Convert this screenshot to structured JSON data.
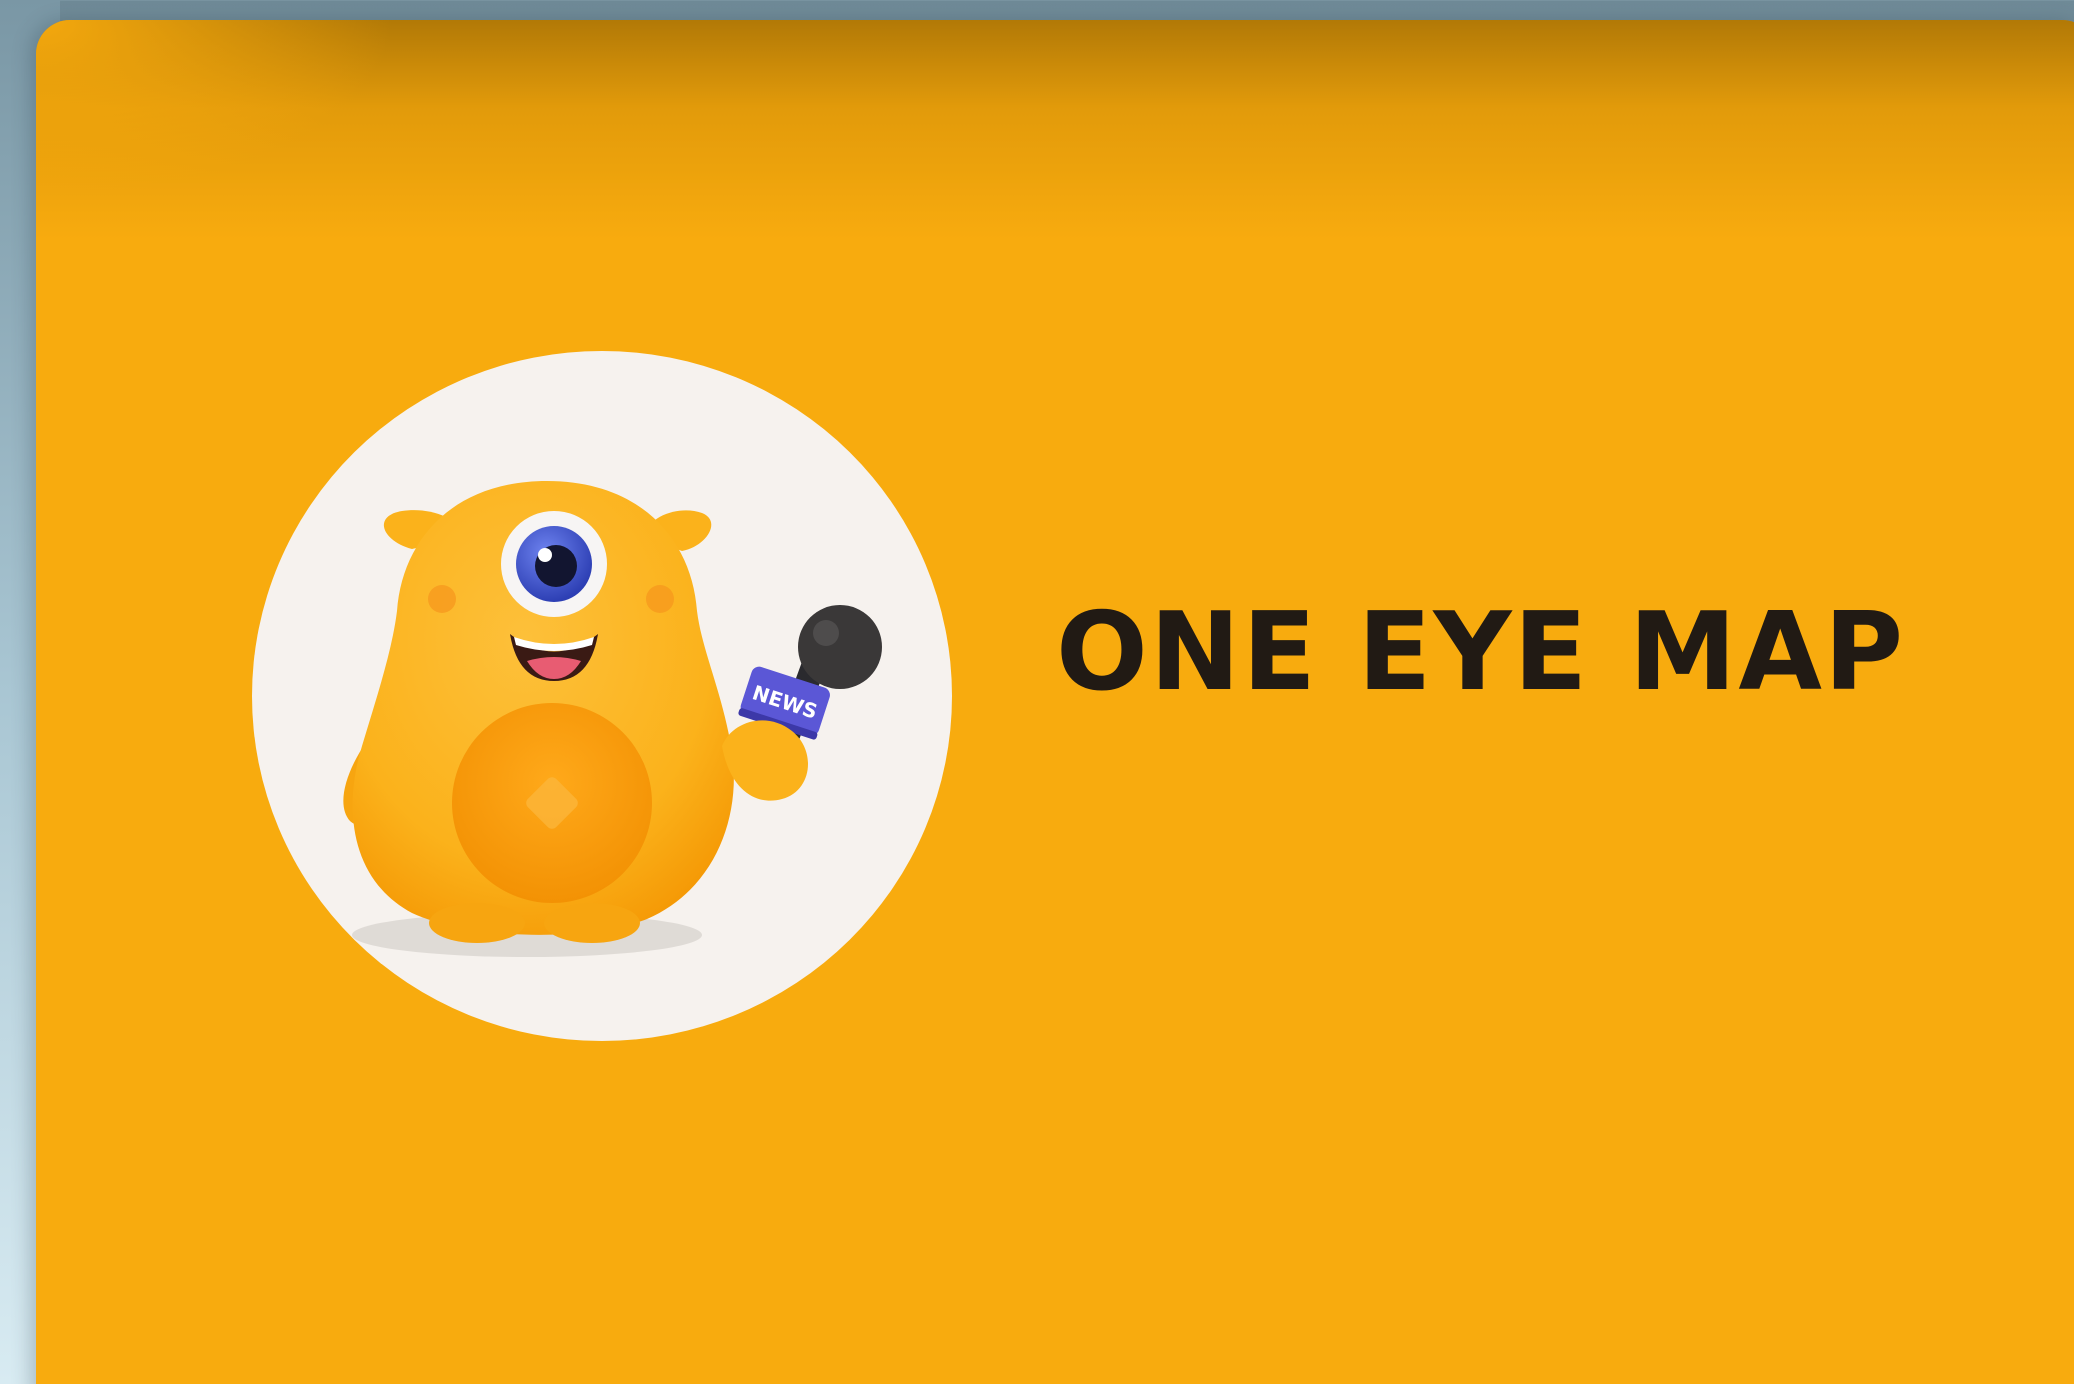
{
  "brand": {
    "title": "ONE EYE MAP",
    "logo_name": "one-eye-mascot-logo",
    "microphone_flag_text": "NEWS"
  },
  "colors": {
    "background": "#f8ab0e",
    "logo_circle": "#f6f2ee",
    "title_text": "#211a14",
    "mascot_body": "#fbb21b",
    "mascot_belly": "#f79e09",
    "iris": "#3a52c8",
    "mic_flag": "#5b57d6"
  }
}
